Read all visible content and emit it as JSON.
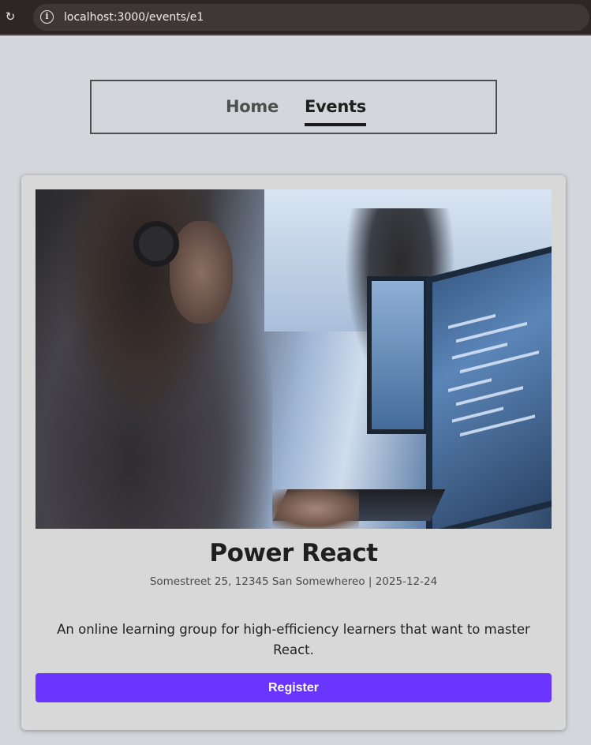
{
  "browser": {
    "url": "localhost:3000/events/e1",
    "reload_icon": "reload-icon",
    "info_icon": "info-icon"
  },
  "nav": {
    "items": [
      {
        "label": "Home",
        "active": false
      },
      {
        "label": "Events",
        "active": true
      }
    ]
  },
  "event": {
    "image_alt": "Person with headphones coding at a computer",
    "title": "Power React",
    "meta": "Somestreet 25, 12345 San Somewhereo | 2025-12-24",
    "description": "An online learning group for high-efficiency learners that want to master React.",
    "register_label": "Register"
  },
  "colors": {
    "accent": "#6a35ff",
    "page_bg": "#d3d6db",
    "card_bg": "#d8d8d8",
    "text_dark": "#1f1f1f"
  }
}
